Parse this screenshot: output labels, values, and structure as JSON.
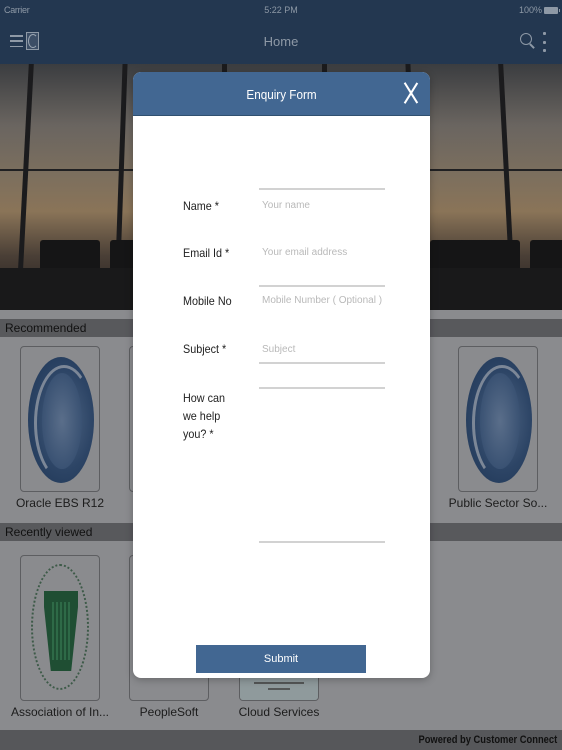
{
  "status_bar": {
    "carrier": "Carrier",
    "time": "5:22 PM",
    "battery": "100%"
  },
  "nav": {
    "title": "Home",
    "icons": [
      "menu-icon",
      "app-logo-icon",
      "search-icon",
      "more-vertical-icon"
    ]
  },
  "sections": [
    {
      "title": "Recommended",
      "items": [
        {
          "label": "Oracle EBS R12",
          "icon": "customer-connect-logo"
        },
        {
          "label": "",
          "icon": "tile-card"
        },
        {
          "label": "Public Sector So...",
          "icon": "customer-connect-logo"
        }
      ]
    },
    {
      "title": "Recently viewed",
      "items": [
        {
          "label": "Association of In...",
          "icon": "keystone-seal-logo"
        },
        {
          "label": "PeopleSoft",
          "icon": "tile-card"
        },
        {
          "label": "Cloud Services",
          "icon": "cloud-services-image"
        }
      ]
    }
  ],
  "footer": {
    "text": "Powered by Customer Connect"
  },
  "modal": {
    "title": "Enquiry Form",
    "close_icon": "close-icon",
    "fields": [
      {
        "label": "Name *",
        "placeholder": "Your name",
        "value": ""
      },
      {
        "label": "Email Id *",
        "placeholder": "Your email address",
        "value": ""
      },
      {
        "label": "Mobile No",
        "placeholder": "Mobile Number ( Optional )",
        "value": ""
      },
      {
        "label": "Subject *",
        "placeholder": "Subject",
        "value": ""
      },
      {
        "label": "How can we help you? *",
        "placeholder": "",
        "value": ""
      }
    ],
    "submit_label": "Submit"
  },
  "colors": {
    "navbar": "#233750",
    "modal_header": "#426792",
    "submit_button": "#426792",
    "page_bg": "#8a8b8e",
    "section_header": "#58595c"
  }
}
